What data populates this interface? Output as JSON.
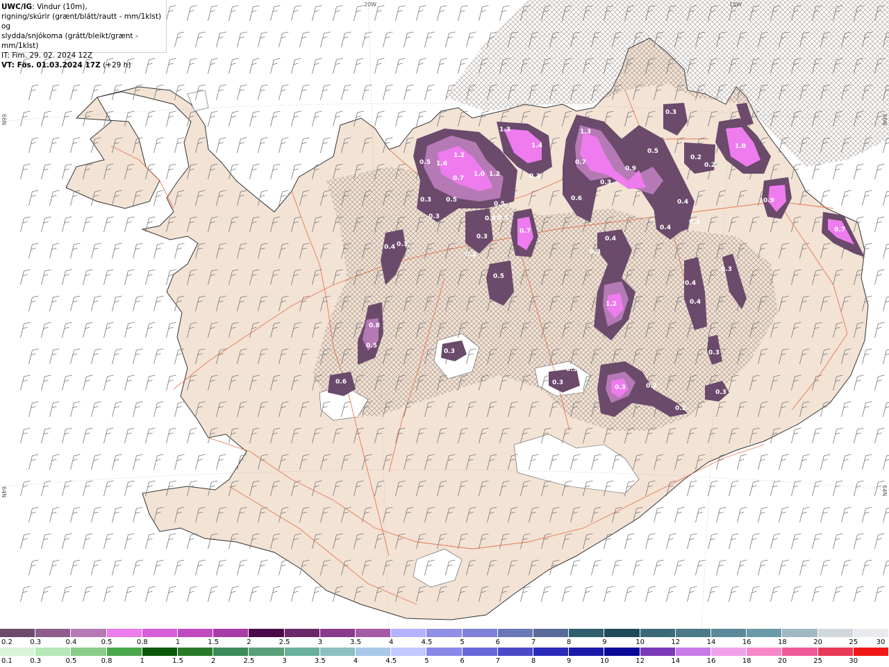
{
  "header": {
    "product": "UWC/IG",
    "description_line1": ": Vindur (10m),",
    "description_line2": "rigning/skúrir (grænt/blátt/rautt - mm/1klst) og",
    "description_line3": "slydda/snjókoma (grátt/bleikt/grænt - mm/1klst)",
    "issue_time": "IT: Fim. 29. 02. 2024 12Z",
    "valid_prefix": "VT: Fös. 01.03.2024 17Z",
    "valid_suffix": " (+29 h)"
  },
  "graticule": {
    "lon_labels": [
      "20W",
      "15W"
    ],
    "lat_labels_left": [
      "66N",
      "64N"
    ],
    "lat_labels_right": [
      "66N",
      "64N"
    ]
  },
  "colors": {
    "land": "#f2e3d5",
    "sea": "#ffffff",
    "roads": "#e8643a",
    "sleet_scale": [
      "#6b4a6b",
      "#8e5d8e",
      "#b57ab5",
      "#ee7cee",
      "#d65ed6",
      "#c04bc0",
      "#a83ca8",
      "#4a0a4a",
      "#6a2a6a",
      "#8a3a8a",
      "#a45aa4",
      "#b2b2ff",
      "#9090e8",
      "#8080d8",
      "#6a78b8",
      "#5a6a98",
      "#2f5f6f",
      "#1f4a5a",
      "#3a6a7a",
      "#4a7a8a",
      "#5a8a9a",
      "#6a9aaa",
      "#a0b8c0",
      "#d0d8dc",
      "#e8eaee"
    ],
    "rain_scale": [
      "#d8f5d8",
      "#b8e8b8",
      "#88cc88",
      "#4aa84a",
      "#0a5a0a",
      "#2a7a2a",
      "#3a8a5a",
      "#5aa07a",
      "#6ab09a",
      "#8ac0c0",
      "#a8c8e8",
      "#c0c8ff",
      "#8888e8",
      "#6868d8",
      "#4a4ac8",
      "#2a2ab8",
      "#1a1aa8",
      "#0a0a98",
      "#7a3ab8",
      "#c87ae8",
      "#f0a0e8",
      "#f888c8",
      "#f05a98",
      "#e83a58",
      "#f01818"
    ]
  },
  "legend_sleet": {
    "labels": [
      "0.2",
      "0.3",
      "0.4",
      "0.5",
      "0.8",
      "1",
      "1.5",
      "2",
      "2.5",
      "3",
      "3.5",
      "4",
      "4.5",
      "5",
      "6",
      "7",
      "8",
      "9",
      "10",
      "12",
      "14",
      "16",
      "18",
      "20",
      "25",
      "30"
    ]
  },
  "legend_rain": {
    "labels": [
      "0.1",
      "0.3",
      "0.5",
      "0.8",
      "1",
      "1.5",
      "2",
      "2.5",
      "3",
      "3.5",
      "4",
      "4.5",
      "5",
      "6",
      "7",
      "8",
      "9",
      "10",
      "12",
      "14",
      "16",
      "18",
      "20",
      "25",
      "30"
    ]
  },
  "precip_labels": [
    "0.5",
    "1.6",
    "1.2",
    "0.7",
    "1.0",
    "1.2",
    "0.3",
    "0.5",
    "0.3",
    "0.5",
    "0.4",
    "0.4",
    "0.3",
    "0.2",
    "0.7",
    "0.5",
    "1.3",
    "1.4",
    "0.3",
    "1.3",
    "0.7",
    "0.5",
    "0.9",
    "0.3",
    "0.6",
    "0.3",
    "0.4",
    "0.4",
    "0.3",
    "0.3",
    "0.4",
    "0.3",
    "1.2",
    "0.4",
    "0.4",
    "0.3",
    "0.2",
    "0.2",
    "1.0",
    "0.9",
    "0.7",
    "0.3",
    "0.4",
    "0.3",
    "0.8",
    "0.5",
    "0.3",
    "0.6",
    "0.3",
    "0.2",
    "0.3",
    "0.2",
    "0.3"
  ]
}
